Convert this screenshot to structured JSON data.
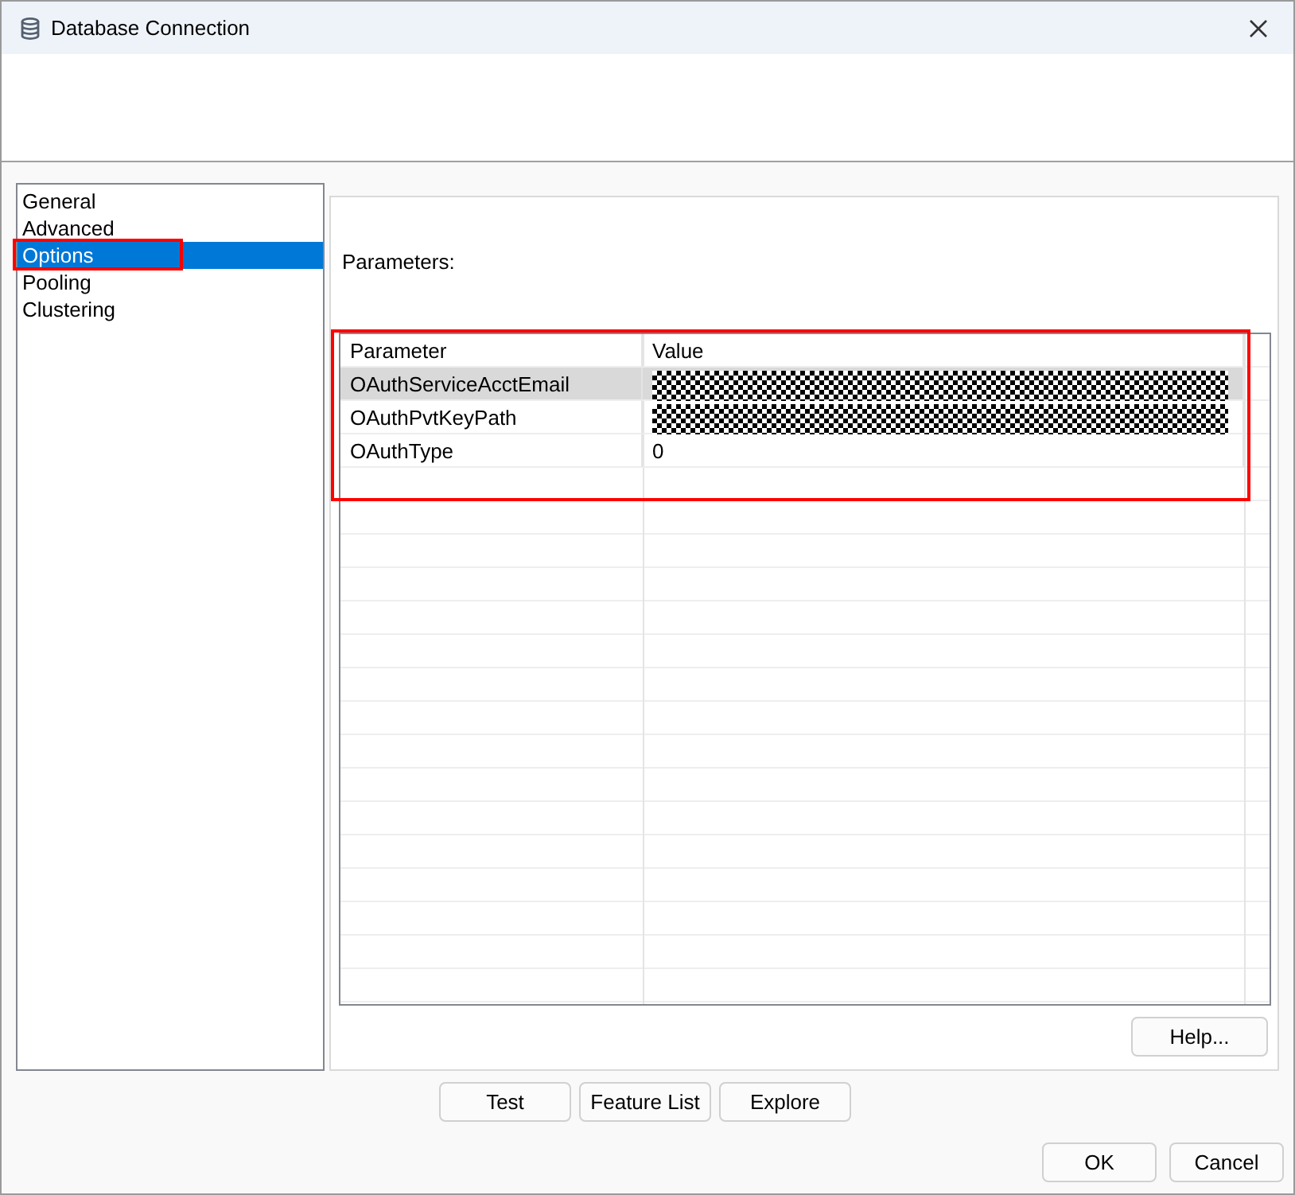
{
  "window": {
    "title": "Database Connection"
  },
  "sidebar": {
    "items": [
      {
        "label": "General",
        "selected": false,
        "highlighted": false
      },
      {
        "label": "Advanced",
        "selected": false,
        "highlighted": false
      },
      {
        "label": "Options",
        "selected": true,
        "highlighted": true
      },
      {
        "label": "Pooling",
        "selected": false,
        "highlighted": false
      },
      {
        "label": "Clustering",
        "selected": false,
        "highlighted": false
      }
    ]
  },
  "parameters": {
    "label": "Parameters:",
    "highlighted": true,
    "table": {
      "columns": [
        "Parameter",
        "Value"
      ],
      "rows": [
        {
          "parameter": "OAuthServiceAcctEmail",
          "value_redacted": true,
          "selected": true
        },
        {
          "parameter": "OAuthPvtKeyPath",
          "value_redacted": true,
          "selected": false
        },
        {
          "parameter": "OAuthType",
          "value": "0",
          "value_redacted": false,
          "selected": false
        }
      ]
    }
  },
  "help_button": "Help...",
  "action_buttons": [
    "Test",
    "Feature List",
    "Explore"
  ],
  "dialog_buttons": [
    "OK",
    "Cancel"
  ]
}
